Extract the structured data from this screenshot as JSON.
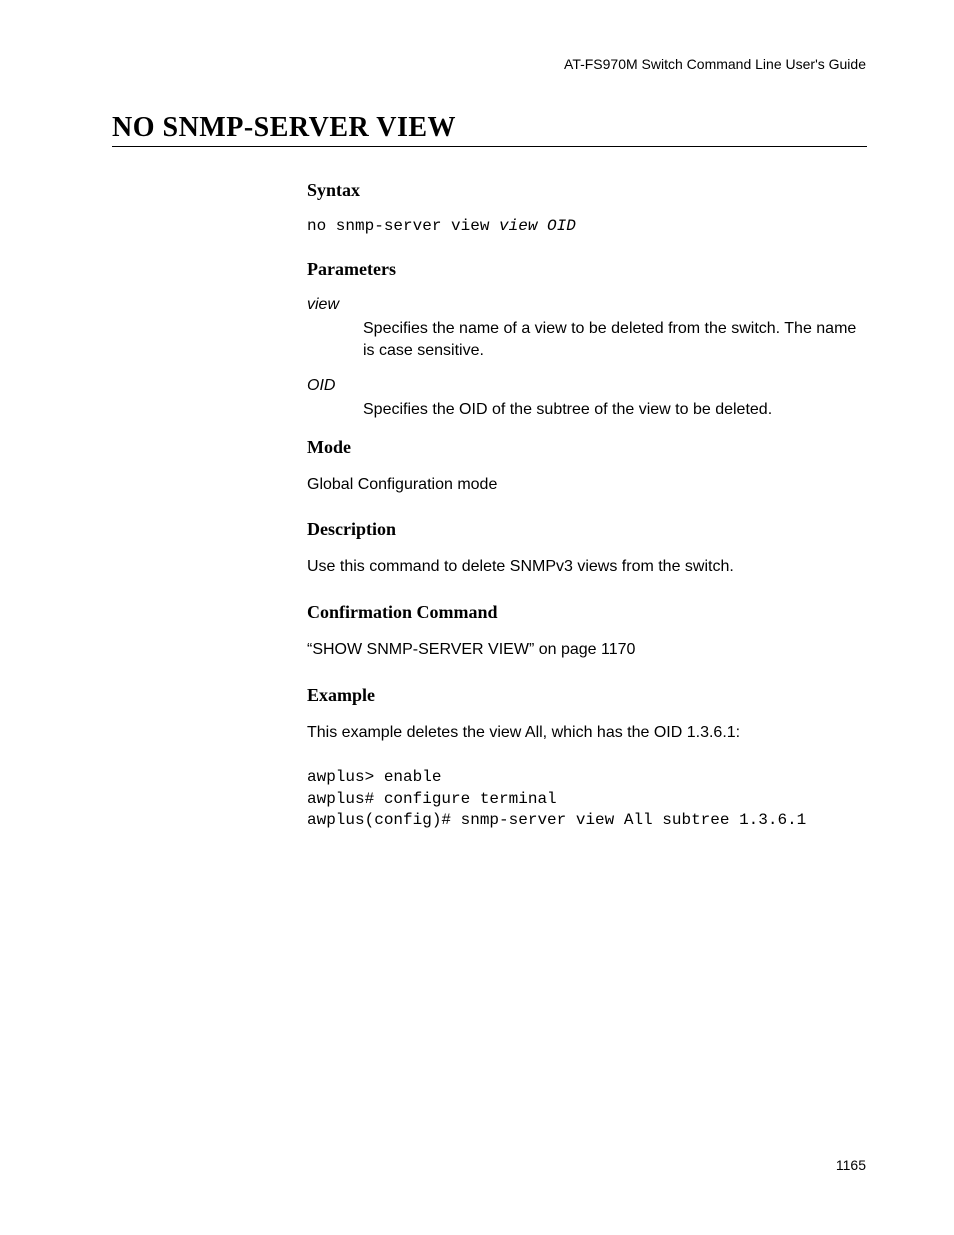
{
  "header": {
    "guide_title": "AT-FS970M Switch Command Line User's Guide"
  },
  "title": "NO SNMP-SERVER VIEW",
  "sections": {
    "syntax": {
      "heading": "Syntax",
      "command_prefix": "no snmp-server view ",
      "command_italic": "view OID"
    },
    "parameters": {
      "heading": "Parameters",
      "items": [
        {
          "name": "view",
          "desc": "Specifies the name of a view to be deleted from the switch. The name is case sensitive."
        },
        {
          "name": "OID",
          "desc": "Specifies the OID of the subtree of the view to be deleted."
        }
      ]
    },
    "mode": {
      "heading": "Mode",
      "text": "Global Configuration mode"
    },
    "description": {
      "heading": "Description",
      "text": "Use this command to delete SNMPv3 views from the switch."
    },
    "confirmation": {
      "heading": "Confirmation Command",
      "text": "“SHOW SNMP-SERVER VIEW” on page 1170"
    },
    "example": {
      "heading": "Example",
      "intro": "This example deletes the view All, which has the OID 1.3.6.1:",
      "code": "awplus> enable\nawplus# configure terminal\nawplus(config)# snmp-server view All subtree 1.3.6.1"
    }
  },
  "page_number": "1165"
}
